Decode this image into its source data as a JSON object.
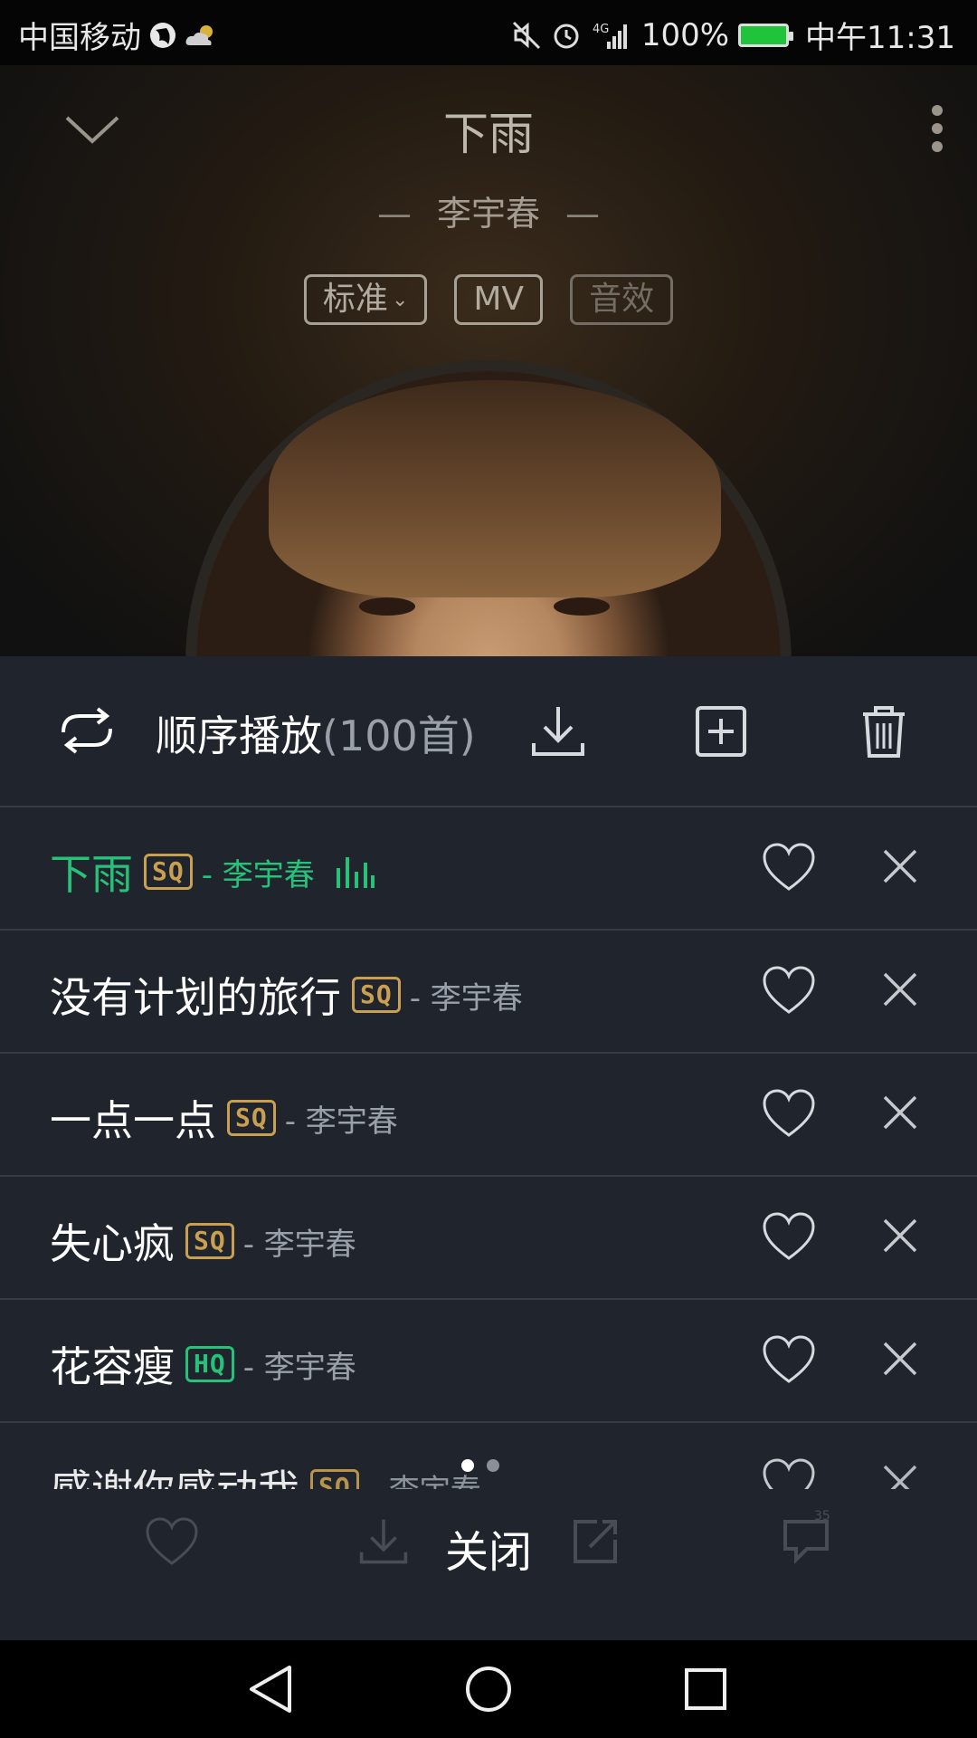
{
  "status_bar": {
    "carrier": "中国移动",
    "battery": "100%",
    "time": "中午11:31",
    "network": "4G",
    "icons": [
      "globe-icon",
      "weather-icon",
      "mute-icon",
      "alarm-icon",
      "signal-icon",
      "battery-icon"
    ]
  },
  "player": {
    "song_title": "下雨",
    "artist": "李宇春",
    "artist_dash": "—",
    "quality_tag": "标准",
    "mv_tag": "MV",
    "effect_tag": "音效"
  },
  "playlist": {
    "mode_label": "顺序播放",
    "count_label": "(100首)",
    "items": [
      {
        "name": "下雨",
        "badge": "SQ",
        "artist": "- 李宇春",
        "active": true
      },
      {
        "name": "没有计划的旅行",
        "badge": "SQ",
        "artist": "- 李宇春",
        "active": false
      },
      {
        "name": "一点一点",
        "badge": "SQ",
        "artist": "- 李宇春",
        "active": false
      },
      {
        "name": "失心疯",
        "badge": "SQ",
        "artist": "- 李宇春",
        "active": false
      },
      {
        "name": "花容瘦",
        "badge": "HQ",
        "artist": "- 李宇春",
        "active": false
      },
      {
        "name": "感谢你感动我",
        "badge": "SQ",
        "artist": "- 李宇春",
        "active": false
      }
    ],
    "close_label": "关闭",
    "comment_count": "35"
  },
  "colors": {
    "accent_green": "#27c27a",
    "sq_gold": "#c9a052",
    "sheet_bg": "#1f242d"
  }
}
